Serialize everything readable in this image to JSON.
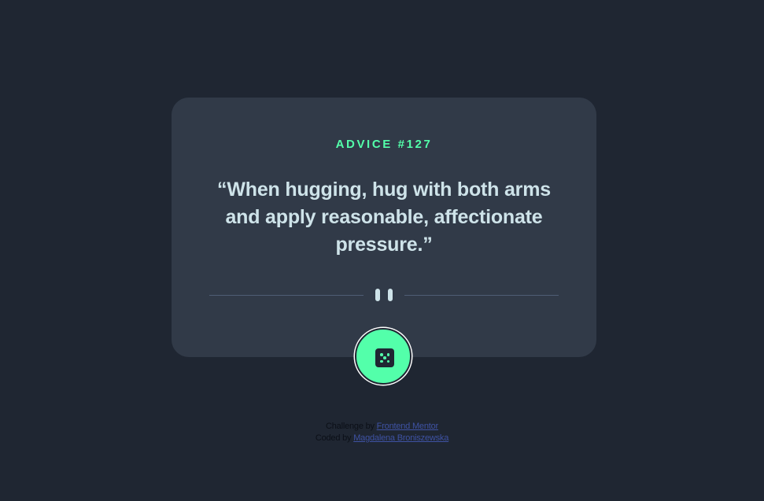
{
  "card": {
    "label_prefix": "ADVICE #",
    "advice_number": "127",
    "quote": "“When hugging, hug with both arms and apply reasonable, affectionate pressure.”"
  },
  "divider": {
    "icon": "pause-icon"
  },
  "button": {
    "icon": "dice-icon"
  },
  "attribution": {
    "challenge_prefix": "Challenge by",
    "challenge_link": "Frontend Mentor",
    "coded_prefix": "Coded by",
    "coded_link": "Magdalena Broniszewska"
  },
  "colors": {
    "background": "#1f2632",
    "card": "#313a48",
    "accent": "#53ffaa",
    "quote_text": "#cee3e9",
    "divider": "#4f5d74",
    "link": "#3e52a3"
  }
}
